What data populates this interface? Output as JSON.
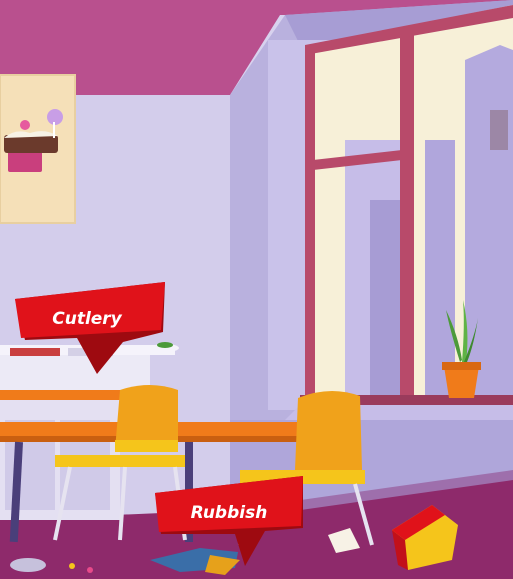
{
  "scene": {
    "labels": {
      "cutlery": "Cutlery",
      "rubbish": "Rubbish"
    },
    "icons": {
      "cake_poster": "cake-poster-icon",
      "plant": "potted-plant-icon"
    },
    "colors": {
      "wall": "#d3cdeb",
      "ceiling": "#c55a98",
      "banner_red": "#e0121a",
      "banner_dark": "#9e0a10",
      "table_orange": "#f07b1a",
      "chair_yellow": "#f5c51b",
      "floor": "#8e2a6b",
      "window_frame": "#b84a6a"
    }
  }
}
